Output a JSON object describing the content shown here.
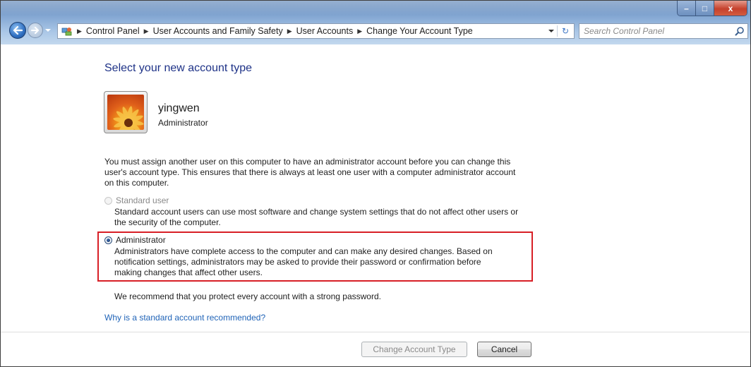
{
  "window": {
    "controls": {
      "minimize": "–",
      "maximize": "□",
      "close": "x"
    }
  },
  "breadcrumbs": [
    "Control Panel",
    "User Accounts and Family Safety",
    "User Accounts",
    "Change Your Account Type"
  ],
  "search": {
    "placeholder": "Search Control Panel"
  },
  "content": {
    "heading": "Select your new account type",
    "user": {
      "name": "yingwen",
      "type": "Administrator"
    },
    "notice_line1": "You must assign another user on this computer to have an administrator account before you can change this",
    "notice_line2": "user's account type. This ensures that there is always at least one user with a computer administrator account",
    "notice_line3": "on this computer.",
    "options": {
      "standard": {
        "label": "Standard user",
        "desc_line1": "Standard account users can use most software and change system settings that do not affect other users or",
        "desc_line2": "the security of the computer.",
        "selected": false,
        "enabled": false
      },
      "administrator": {
        "label": "Administrator",
        "desc_line1": "Administrators have complete access to the computer and can make any desired changes. Based on",
        "desc_line2": "notification settings, administrators may be asked to provide their password or confirmation before",
        "desc_line3": "making changes that affect other users.",
        "selected": true,
        "enabled": true
      }
    },
    "recommendation": "We recommend that you protect every account with a strong password.",
    "help_link": "Why is a standard account recommended?"
  },
  "buttons": {
    "change": {
      "label": "Change Account Type",
      "enabled": false
    },
    "cancel": {
      "label": "Cancel",
      "enabled": true
    }
  },
  "colors": {
    "heading": "#1e3287",
    "link": "#1f63b7",
    "highlight_box": "#d81f26"
  }
}
